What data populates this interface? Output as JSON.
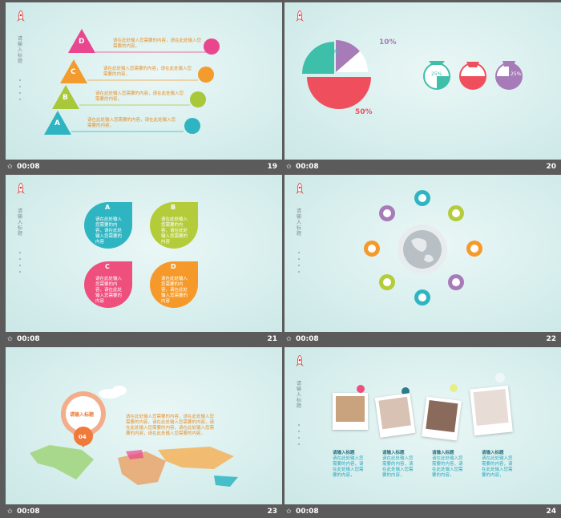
{
  "slides": [
    {
      "number": "19",
      "duration": "00:08",
      "vertical_title": "请输入标题",
      "levels": [
        {
          "letter": "D",
          "color": "#e9468d",
          "text": "请在此处输入您需要的内容，请在此处输入您需要的内容，",
          "icon_color": "#e9468d"
        },
        {
          "letter": "C",
          "color": "#f39c2d",
          "text": "请在此处输入您需要的内容，请在此处输入您需要的内容，",
          "icon_color": "#f39c2d"
        },
        {
          "letter": "B",
          "color": "#a8c83a",
          "text": "请在此处输入您需要的内容，请在此处输入您需要的内容，",
          "icon_color": "#a8c83a"
        },
        {
          "letter": "A",
          "color": "#2fb5c2",
          "text": "请在此处输入您需要的内容，请在此处输入您需要的内容，",
          "icon_color": "#2fb5c2"
        }
      ]
    },
    {
      "number": "20",
      "duration": "00:08",
      "pie_labels": [
        "25%",
        "10%",
        "50%"
      ],
      "gauge_labels": [
        "25%",
        "25%",
        "25%"
      ]
    },
    {
      "number": "21",
      "duration": "00:08",
      "vertical_title": "请输入标题",
      "cards": [
        {
          "letter": "A",
          "color": "#2fb5c2",
          "text": "请在此处输入您需要的内容，请在此处输入您需要的内容"
        },
        {
          "letter": "B",
          "color": "#b5cc3a",
          "text": "请在此处输入您需要的内容，请在此处输入您需要的内容"
        },
        {
          "letter": "C",
          "color": "#ee4f7d",
          "text": "请在此处输入您需要的内容，请在此处输入您需要的内容"
        },
        {
          "letter": "D",
          "color": "#f59a2a",
          "text": "请在此处输入您需要的内容，请在此处输入您需要的内容"
        }
      ]
    },
    {
      "number": "22",
      "duration": "00:08",
      "vertical_title": "请输入标题"
    },
    {
      "number": "23",
      "duration": "00:08",
      "pin_title": "请输入标题",
      "pin_number": "04",
      "text": "请在此处输入您需要的内容，请在此处输入您需要的内容，请在此处输入您需要的内容，请在此处输入您需要的内容，请在此处输入您需要的内容，请在此处输入您需要的内容，"
    },
    {
      "number": "24",
      "duration": "00:08",
      "vertical_title": "请输入标题",
      "photos": [
        {
          "title": "请输入标题",
          "text": "请在此处输入您需要的内容，请在此处输入您需要的内容，"
        },
        {
          "title": "请输入标题",
          "text": "请在此处输入您需要的内容，请在此处输入您需要的内容，"
        },
        {
          "title": "请输入标题",
          "text": "请在此处输入您需要的内容，请在此处输入您需要的内容，"
        },
        {
          "title": "请输入标题",
          "text": "请在此处输入您需要的内容，请在此处输入您需要的内容，"
        }
      ]
    }
  ]
}
